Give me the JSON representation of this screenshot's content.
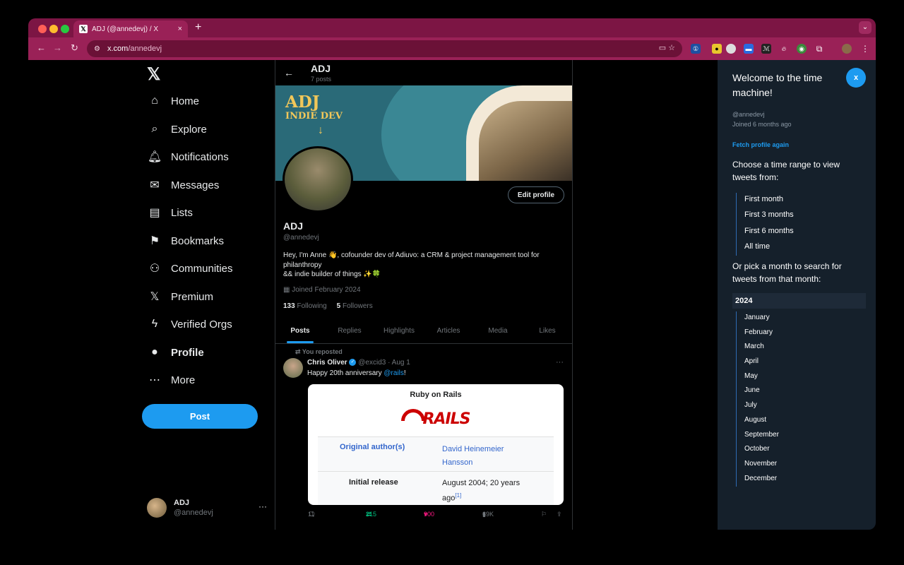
{
  "browser": {
    "tab_title": "ADJ (@annedevj) / X",
    "tab_close": "×",
    "new_tab": "+",
    "url_host": "x.com",
    "url_path": "/annedevj"
  },
  "sidebar": {
    "items": [
      {
        "label": "Home",
        "icon": "⌂"
      },
      {
        "label": "Explore",
        "icon": "⌕"
      },
      {
        "label": "Notifications",
        "icon": "🔔︎"
      },
      {
        "label": "Messages",
        "icon": "✉"
      },
      {
        "label": "Lists",
        "icon": "▤"
      },
      {
        "label": "Bookmarks",
        "icon": "⚑"
      },
      {
        "label": "Communities",
        "icon": "⚇"
      },
      {
        "label": "Premium",
        "icon": "𝕏"
      },
      {
        "label": "Verified Orgs",
        "icon": "ϟ"
      },
      {
        "label": "Profile",
        "icon": "●"
      },
      {
        "label": "More",
        "icon": "⋯"
      }
    ],
    "post_button": "Post",
    "account": {
      "name": "ADJ",
      "handle": "@annedevj"
    }
  },
  "profile_header": {
    "name": "ADJ",
    "post_count": "7 posts"
  },
  "banner": {
    "line1": "ADJ",
    "line2": "INDIE DEV"
  },
  "profile": {
    "edit_button": "Edit profile",
    "name": "ADJ",
    "handle": "@annedevj",
    "bio_line1": "Hey, I'm Anne 👋, cofounder dev of Adiuvo: a CRM & project management tool for philanthropy",
    "bio_line2": "&& indie builder of things ✨🍀",
    "joined": "Joined February 2024",
    "following_count": "133",
    "following_label": "Following",
    "followers_count": "5",
    "followers_label": "Followers"
  },
  "profile_tabs": [
    "Posts",
    "Replies",
    "Highlights",
    "Articles",
    "Media",
    "Likes"
  ],
  "tweet": {
    "repost_label": "You reposted",
    "author": "Chris Oliver",
    "handle": "@excid3",
    "date": "· Aug 1",
    "text_before": "Happy 20th anniversary ",
    "mention": "@rails",
    "text_after": "!",
    "card": {
      "title": "Ruby on Rails",
      "logo_text": "RAILS",
      "row1_label": "Original author(s)",
      "row1_value": "David Heinemeier Hansson",
      "row2_label": "Initial release",
      "row2_value": "August 2004; 20 years ago",
      "row2_ref": "[1]"
    },
    "replies": "11",
    "reposts": "215",
    "likes": "900",
    "views": "69K"
  },
  "panel": {
    "welcome": "Welcome to the time machine!",
    "close_label": "x",
    "handle": "@annedevj",
    "joined": "Joined 6 months ago",
    "fetch_link": "Fetch profile again",
    "choose_text": "Choose a time range to view tweets from:",
    "ranges": [
      "First month",
      "First 3 months",
      "First 6 months",
      "All time"
    ],
    "pick_text": "Or pick a month to search for tweets from that month:",
    "year": "2024",
    "months": [
      "January",
      "February",
      "March",
      "April",
      "May",
      "June",
      "July",
      "August",
      "September",
      "October",
      "November",
      "December"
    ]
  },
  "colors": {
    "accent": "#1d9bf0",
    "browser_frame": "#9a2157",
    "panel_bg": "#15202b",
    "like": "#f91880",
    "repost": "#00ba7c"
  }
}
